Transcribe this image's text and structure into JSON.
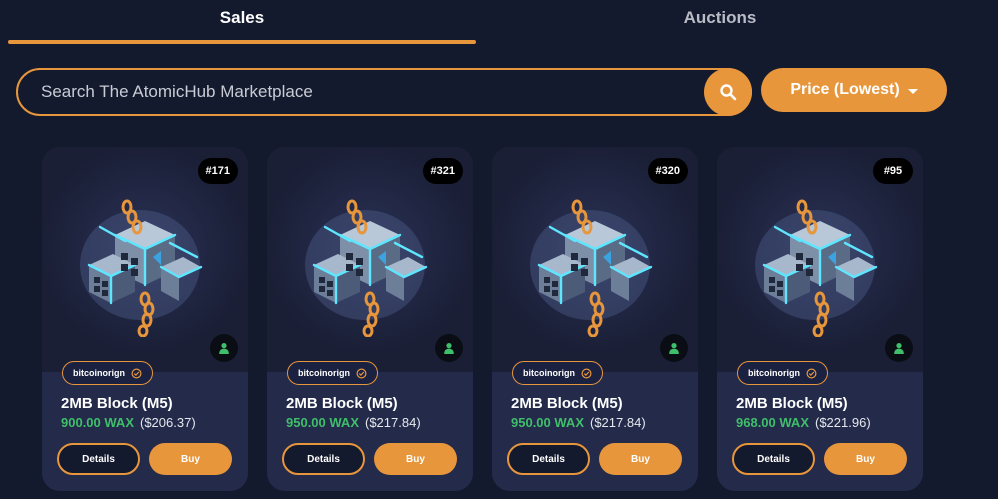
{
  "tabs": {
    "sales": "Sales",
    "auctions": "Auctions"
  },
  "search": {
    "placeholder": "Search The AtomicHub Marketplace",
    "icon": "search-icon"
  },
  "sort": {
    "label": "Price (Lowest)"
  },
  "colors": {
    "accent": "#e8963c",
    "price_green": "#3fbf6a",
    "background": "#141a2e"
  },
  "cards": [
    {
      "number": "#171",
      "collection": "bitcoinorign",
      "name": "2MB Block (M5)",
      "price_wax": "900.00 WAX",
      "price_usd": "($206.37)",
      "details_label": "Details",
      "buy_label": "Buy"
    },
    {
      "number": "#321",
      "collection": "bitcoinorign",
      "name": "2MB Block (M5)",
      "price_wax": "950.00 WAX",
      "price_usd": "($217.84)",
      "details_label": "Details",
      "buy_label": "Buy"
    },
    {
      "number": "#320",
      "collection": "bitcoinorign",
      "name": "2MB Block (M5)",
      "price_wax": "950.00 WAX",
      "price_usd": "($217.84)",
      "details_label": "Details",
      "buy_label": "Buy"
    },
    {
      "number": "#95",
      "collection": "bitcoinorign",
      "name": "2MB Block (M5)",
      "price_wax": "968.00 WAX",
      "price_usd": "($221.96)",
      "details_label": "Details",
      "buy_label": "Buy"
    }
  ]
}
